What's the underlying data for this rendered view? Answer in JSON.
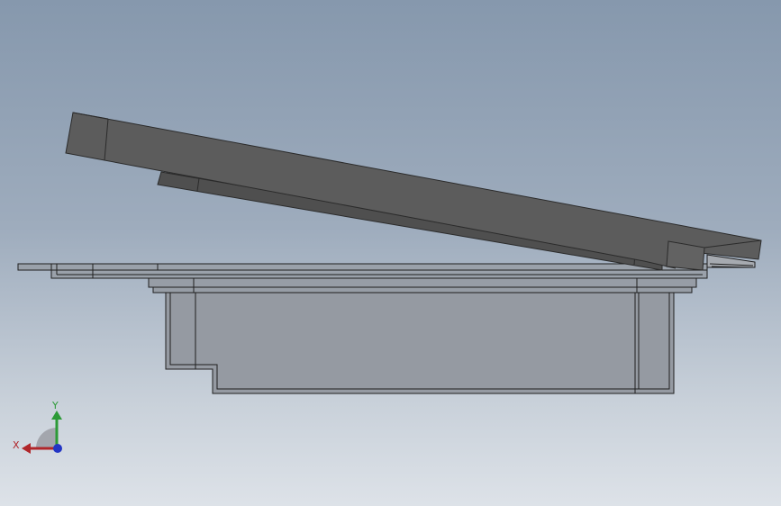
{
  "viewport": {
    "background_top": "#8698ad",
    "background_bottom": "#dde2e8"
  },
  "model": {
    "lid_color": "#5c5c5c",
    "lid_edge_color": "#2b2b2b",
    "housing_color": "#959aa2",
    "flange_color": "#9aa1aa",
    "edge_color": "#1f1f1f"
  },
  "triad": {
    "x_label": "X",
    "y_label": "Y",
    "x_color": "#b0262a",
    "y_color": "#2c9a37",
    "z_color": "#2335c4"
  }
}
